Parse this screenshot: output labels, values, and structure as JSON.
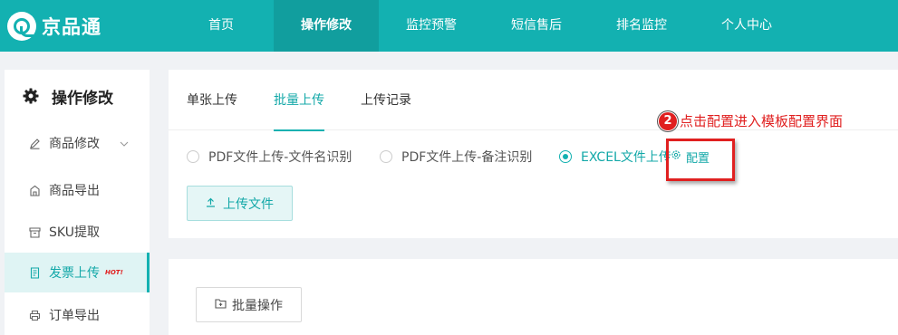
{
  "app": {
    "name": "京品通"
  },
  "nav": {
    "items": [
      {
        "label": "首页"
      },
      {
        "label": "操作修改",
        "active": true
      },
      {
        "label": "监控预警"
      },
      {
        "label": "短信售后"
      },
      {
        "label": "排名监控"
      },
      {
        "label": "个人中心"
      }
    ]
  },
  "sidebar": {
    "title": "操作修改",
    "items": [
      {
        "label": "商品修改",
        "icon": "pen-icon",
        "has_submenu": true
      },
      {
        "label": "商品导出",
        "icon": "export-icon"
      },
      {
        "label": "SKU提取",
        "icon": "box-icon"
      },
      {
        "label": "发票上传",
        "icon": "document-icon",
        "badge": "HOT!",
        "active": true
      },
      {
        "label": "订单导出",
        "icon": "printer-icon"
      }
    ]
  },
  "tabs": [
    {
      "label": "单张上传"
    },
    {
      "label": "批量上传",
      "active": true
    },
    {
      "label": "上传记录"
    }
  ],
  "upload_options": [
    {
      "label": "PDF文件上传-文件名识别",
      "checked": false
    },
    {
      "label": "PDF文件上传-备注识别",
      "checked": false
    },
    {
      "label": "EXCEL文件上传",
      "checked": true
    }
  ],
  "config_link": {
    "label": "配置"
  },
  "upload_button": {
    "label": "上传文件"
  },
  "batch_button": {
    "label": "批量操作"
  },
  "annotation": {
    "number": "2",
    "text": "点击配置进入模板配置界面",
    "color": "#e02020"
  },
  "colors": {
    "brand": "#13b1b1",
    "active_bg": "#dff4f4",
    "annotation": "#e02020"
  }
}
